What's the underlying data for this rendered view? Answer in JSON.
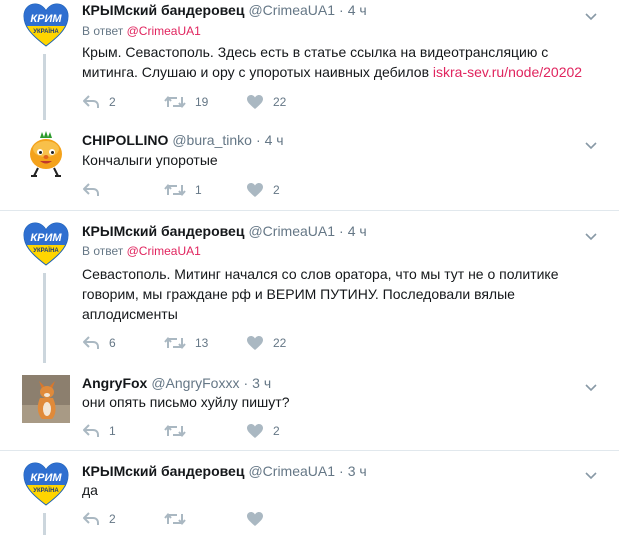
{
  "tweets": [
    {
      "name": "КРЫМский бандеровец",
      "handle": "@CrimeaUA1",
      "time": "4 ч",
      "reply_prefix": "В ответ",
      "reply_to": "@CrimeaUA1",
      "text_line1": "Крым. Севастополь. Здесь есть в статье ссылка на видеотрансляцию с",
      "text_line2_plain": "митинга. Слушаю и ору с упоротых наивных дебилов ",
      "link": "iskra-sev.ru/node/20202",
      "replies": "2",
      "retweets": "19",
      "likes": "22",
      "avatar_text_top": "КРИМ",
      "avatar_text_bottom": "УКРАЇНА"
    },
    {
      "name": "CHIPOLLINO",
      "handle": "@bura_tinko",
      "time": "4 ч",
      "text": "Кончалыги упоротые",
      "replies": "",
      "retweets": "1",
      "likes": "2"
    },
    {
      "name": "КРЫМский бандеровец",
      "handle": "@CrimeaUA1",
      "time": "4 ч",
      "reply_prefix": "В ответ",
      "reply_to": "@CrimeaUA1",
      "text_line1": "Севастополь. Митинг начался со слов оратора, что мы тут не о политике",
      "text_line2": "говорим, мы граждане рф и ВЕРИМ ПУТИНУ. Последовали вялые",
      "text_line3": "аплодисменты",
      "replies": "6",
      "retweets": "13",
      "likes": "22",
      "avatar_text_top": "КРИМ",
      "avatar_text_bottom": "УКРАЇНА"
    },
    {
      "name": "AngryFox",
      "handle": "@AngryFoxxx",
      "time": "3 ч",
      "text": "они опять письмо хуйлу пишут?",
      "replies": "1",
      "retweets": "",
      "likes": "2"
    },
    {
      "name": "КРЫМский бандеровец",
      "handle": "@CrimeaUA1",
      "time": "3 ч",
      "text": "да",
      "replies": "2",
      "retweets": "",
      "likes": "",
      "avatar_text_top": "КРИМ",
      "avatar_text_bottom": "УКРАЇНА"
    }
  ],
  "separator": "·",
  "colors": {
    "accent": "#e0245e",
    "muted": "#657786",
    "thread_line": "#ccd6dd",
    "divider": "#e1e8ed"
  },
  "icons": [
    "reply-icon",
    "retweet-icon",
    "like-icon",
    "chevron-down-icon"
  ]
}
